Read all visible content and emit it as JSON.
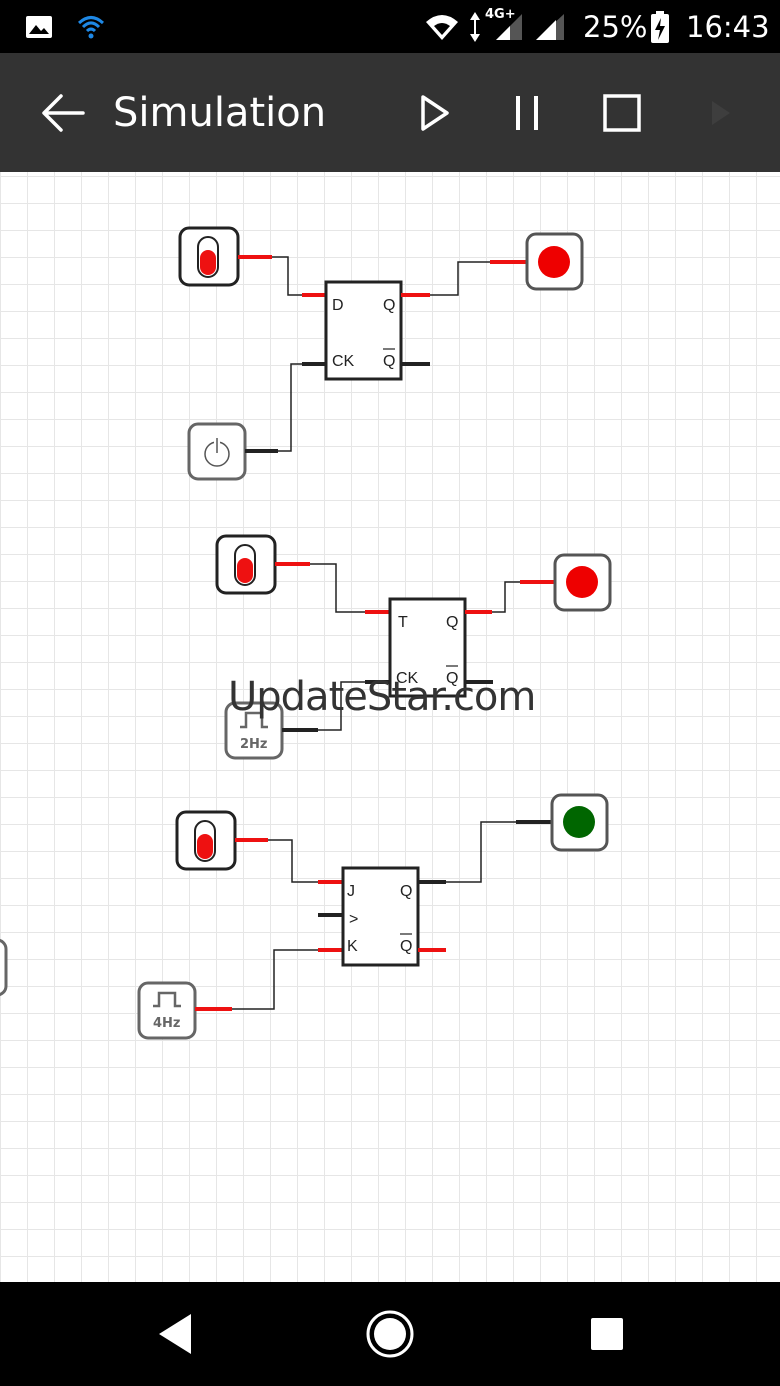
{
  "status_bar": {
    "gallery_icon": "image-icon",
    "wifi_icon": "wifi-icon",
    "network_type": "4G+",
    "battery_percent": "25%",
    "time": "16:43"
  },
  "toolbar": {
    "title": "Simulation",
    "back_icon": "arrow-left-icon",
    "play_icon": "play-icon",
    "pause_icon": "pause-icon",
    "stop_icon": "stop-icon"
  },
  "circuit": {
    "d_flipflop": {
      "pins": {
        "d": "D",
        "ck": "CK",
        "q": "Q",
        "qbar": "Q"
      }
    },
    "t_flipflop": {
      "pins": {
        "t": "T",
        "ck": "CK",
        "q": "Q",
        "qbar": "Q"
      }
    },
    "jk_flipflop": {
      "pins": {
        "j": "J",
        "clk": ">",
        "k": "K",
        "q": "Q",
        "qbar": "Q"
      }
    },
    "clock_2hz": {
      "label": "2Hz"
    },
    "clock_4hz": {
      "label": "4Hz"
    },
    "colors": {
      "signal_high": "#ee1111",
      "signal_low": "#111111",
      "led_on_red": "#ee0000",
      "led_green": "#006600"
    }
  },
  "watermark": "UpdateStar.com",
  "nav_bar": {
    "back_icon": "nav-back-icon",
    "home_icon": "nav-home-icon",
    "recents_icon": "nav-recents-icon"
  }
}
